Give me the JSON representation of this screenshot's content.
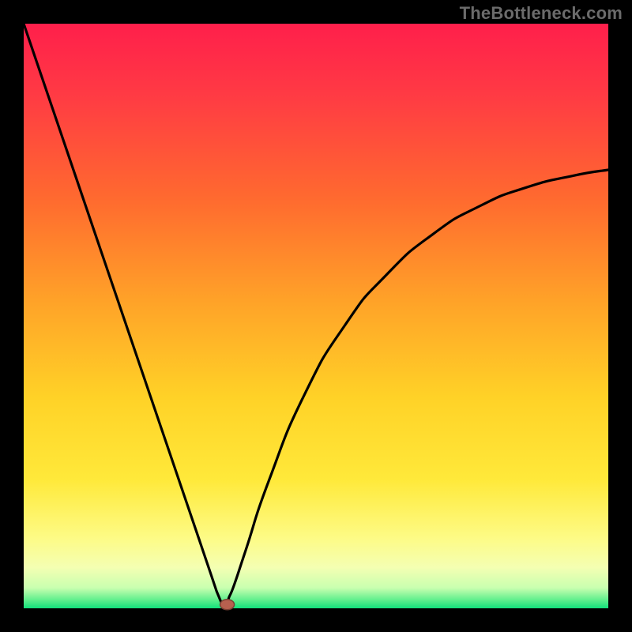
{
  "watermark": "TheBottleneck.com",
  "colors": {
    "frame": "#000000",
    "gradient_stops": [
      {
        "offset": 0.0,
        "color": "#ff1f4b"
      },
      {
        "offset": 0.12,
        "color": "#ff3a44"
      },
      {
        "offset": 0.3,
        "color": "#ff6a2f"
      },
      {
        "offset": 0.48,
        "color": "#ffa428"
      },
      {
        "offset": 0.64,
        "color": "#ffd227"
      },
      {
        "offset": 0.78,
        "color": "#ffe93a"
      },
      {
        "offset": 0.88,
        "color": "#fdfb86"
      },
      {
        "offset": 0.93,
        "color": "#f4ffb2"
      },
      {
        "offset": 0.965,
        "color": "#c9ffb0"
      },
      {
        "offset": 0.985,
        "color": "#63f08e"
      },
      {
        "offset": 1.0,
        "color": "#12e07b"
      }
    ],
    "curve": "#000000",
    "marker_fill": "#b7604f",
    "marker_stroke": "#7a3f33"
  },
  "chart_data": {
    "type": "line",
    "title": "",
    "xlabel": "",
    "ylabel": "",
    "xlim": [
      0,
      100
    ],
    "ylim": [
      0,
      100
    ],
    "grid": false,
    "legend": null,
    "note": "V-shaped bottleneck curve; y represents mismatch % (100 at top of plot, 0 at green bottom). Minimum near x≈34.",
    "series": [
      {
        "name": "bottleneck-curve",
        "x": [
          0,
          5,
          10,
          15,
          20,
          25,
          30,
          32,
          33,
          34,
          35,
          36,
          38,
          42,
          48,
          55,
          62,
          70,
          78,
          86,
          94,
          100
        ],
        "y": [
          100,
          85.3,
          70.6,
          55.9,
          41.2,
          26.5,
          11.8,
          5.9,
          2.9,
          0.5,
          1.5,
          4.0,
          10.0,
          22.0,
          36.5,
          48.5,
          57.0,
          64.0,
          68.8,
          72.0,
          74.0,
          75.0
        ]
      }
    ],
    "marker": {
      "x": 34,
      "y": 0.5
    }
  }
}
